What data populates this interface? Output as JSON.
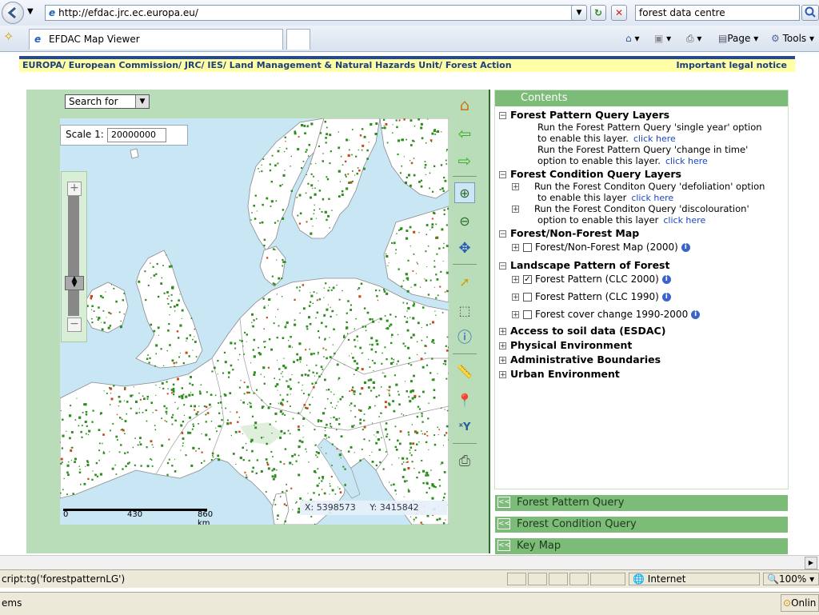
{
  "browser": {
    "address": "http://efdac.jrc.ec.europa.eu/",
    "search_value": "forest data centre",
    "tab_title": "EFDAC Map Viewer",
    "page_menu": "Page",
    "tools_menu": "Tools"
  },
  "breadcrumb": {
    "items": [
      "EUROPA/",
      "European Commission/",
      "JRC/",
      "IES/",
      "Land Management & Natural Hazards Unit/",
      "Forest Action"
    ],
    "legal": "Important legal notice"
  },
  "map": {
    "search_select": "Search for",
    "scale_label": "Scale 1:",
    "scale_value": "20000000",
    "scalebar": {
      "t0": "0",
      "t1": "430",
      "t2": "860 km"
    },
    "coords": {
      "x": "X: 5398573",
      "y": "Y: 3415842"
    }
  },
  "contents": {
    "title": "Contents",
    "groups": {
      "fpq": {
        "label": "Forest Pattern Query Layers",
        "line1a": "Run the Forest Pattern Query 'single year' option",
        "line1b": "to enable this layer.",
        "line2a": "Run the Forest Pattern Query 'change in time'",
        "line2b": "option to enable this layer.",
        "click": "click here"
      },
      "fcq": {
        "label": "Forest Condition Query Layers",
        "line1a": "Run the Forest Conditon Query 'defoliation' option",
        "line1b": "to enable this layer",
        "line2a": "Run the Forest Conditon Query 'discolouration'",
        "line2b": "option to enable this layer",
        "click": "click here"
      },
      "fnf": {
        "label": "Forest/Non-Forest Map",
        "item1": "Forest/Non-Forest Map (2000)"
      },
      "lpf": {
        "label": "Landscape Pattern of Forest",
        "item1": "Forest Pattern (CLC 2000)",
        "item2": "Forest Pattern (CLC 1990)",
        "item3": "Forest cover change 1990-2000"
      },
      "soil": "Access to soil data (ESDAC)",
      "phys": "Physical Environment",
      "admin": "Administrative Boundaries",
      "urban": "Urban Environment"
    },
    "bars": {
      "b1": "Forest Pattern Query",
      "b2": "Forest Condition Query",
      "b3": "Key Map"
    },
    "arrow": "<<"
  },
  "status": {
    "left": "cript:tg('forestpatternLG')",
    "zone": "Internet",
    "zoom": "100%",
    "bottom_left": "ems",
    "bottom_right": "Onlin"
  },
  "colors": {
    "panel_green": "#b9ddb8",
    "bar_green": "#7dbb78",
    "sea": "#c9e6f5",
    "forest": "#2e8b1e",
    "breadcrumb_bg": "#ffffa8",
    "breadcrumb_text": "#1b3f7a"
  }
}
